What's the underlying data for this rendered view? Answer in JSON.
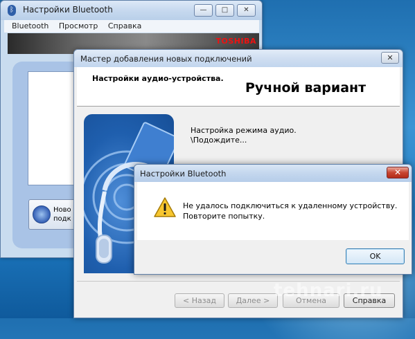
{
  "bt_window": {
    "title": "Настройки Bluetooth",
    "menu": [
      "Bluetooth",
      "Просмотр",
      "Справка"
    ],
    "brand": "TOSHIBA",
    "new_connection_label_line1": "Ново",
    "new_connection_label_line2": "подк",
    "controls": {
      "minimize": "—",
      "maximize": "□",
      "close": "✕"
    }
  },
  "wizard": {
    "title": "Мастер добавления новых подключений",
    "close": "✕",
    "header_title": "Настройки аудио-устройства.",
    "overlay_caption": "Ручной вариант",
    "status_line1": "Настройка режима аудио.",
    "status_line2": "\\Подождите...",
    "buttons": {
      "back": "< Назад",
      "next": "Далее >",
      "cancel": "Отмена",
      "help": "Справка"
    }
  },
  "error_dialog": {
    "title": "Настройки Bluetooth",
    "close": "✕",
    "icon": "warning-icon",
    "message_line1": "Не удалось подключиться к удаленному устройству.",
    "message_line2": "Повторите попытку.",
    "ok_label": "OK"
  },
  "watermark": "tehnari.ru"
}
